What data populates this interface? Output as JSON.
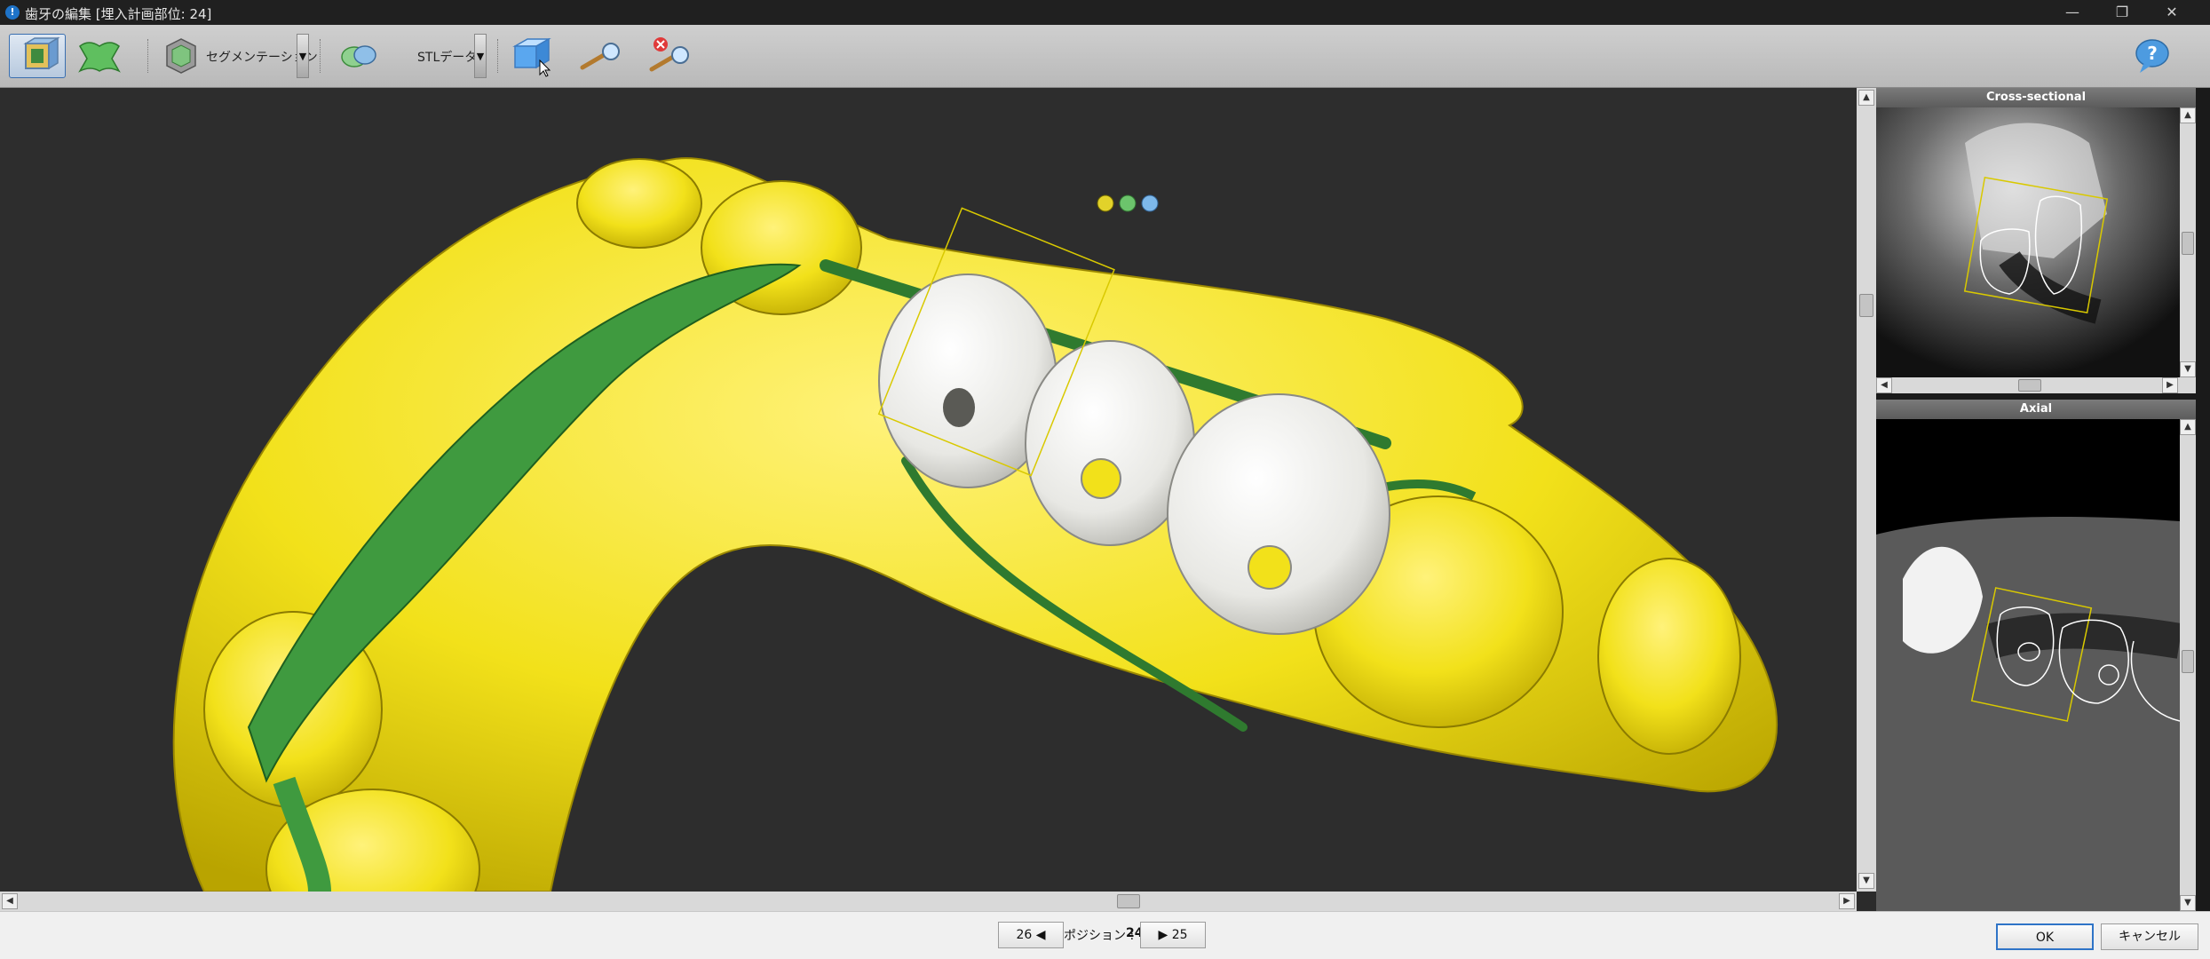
{
  "window": {
    "title": "歯牙の編集 [埋入計画部位: 24]",
    "minimize": "—",
    "restore": "❐",
    "close": "✕"
  },
  "toolbar": {
    "segmentation_label": "セグメンテーション",
    "stl_label": "STLデータ"
  },
  "panels": {
    "cross_sectional": "Cross-sectional",
    "axial": "Axial"
  },
  "navigation": {
    "prev_label": "26 ◀",
    "position_label": "ポジション :",
    "position_value": "24",
    "next_label": "▶ 25"
  },
  "dialog": {
    "ok": "OK",
    "cancel": "キャンセル"
  },
  "colors": {
    "model": "#f2e11a",
    "nerve": "#3a9a3a",
    "crown": "#e8e8e4",
    "accent": "#2f74c7"
  }
}
